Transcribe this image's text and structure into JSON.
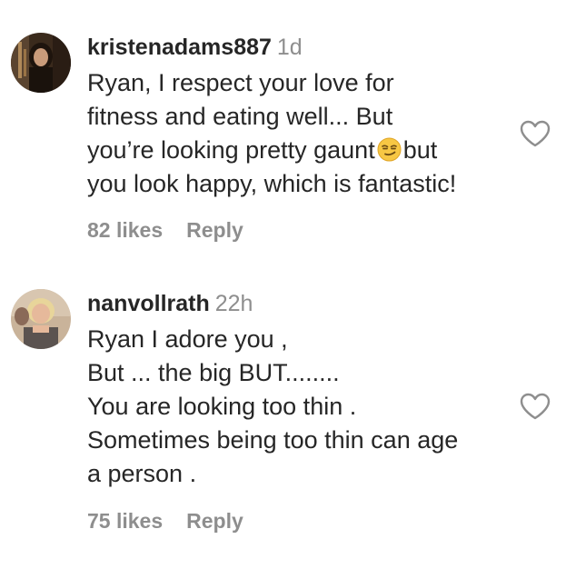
{
  "comments": [
    {
      "username": "kristenadams887",
      "time": "1d",
      "lines": [
        "Ryan, I respect your love for",
        "fitness and eating well... But",
        "you’re looking pretty gaunt",
        "but",
        "you look happy, which is fantastic!"
      ],
      "emoji": "smirking-face-emoji",
      "likes": "82 likes",
      "reply_label": "Reply",
      "like_icon": "heart-outline-icon"
    },
    {
      "username": "nanvollrath",
      "time": "22h",
      "lines": [
        "Ryan I adore you ,",
        "But ... the big BUT........",
        "You are looking too thin .",
        "Sometimes being too thin can age",
        "a person ."
      ],
      "likes": "75 likes",
      "reply_label": "Reply",
      "like_icon": "heart-outline-icon"
    }
  ],
  "colors": {
    "text": "#262626",
    "secondary": "#8e8e8e",
    "background": "#ffffff"
  }
}
